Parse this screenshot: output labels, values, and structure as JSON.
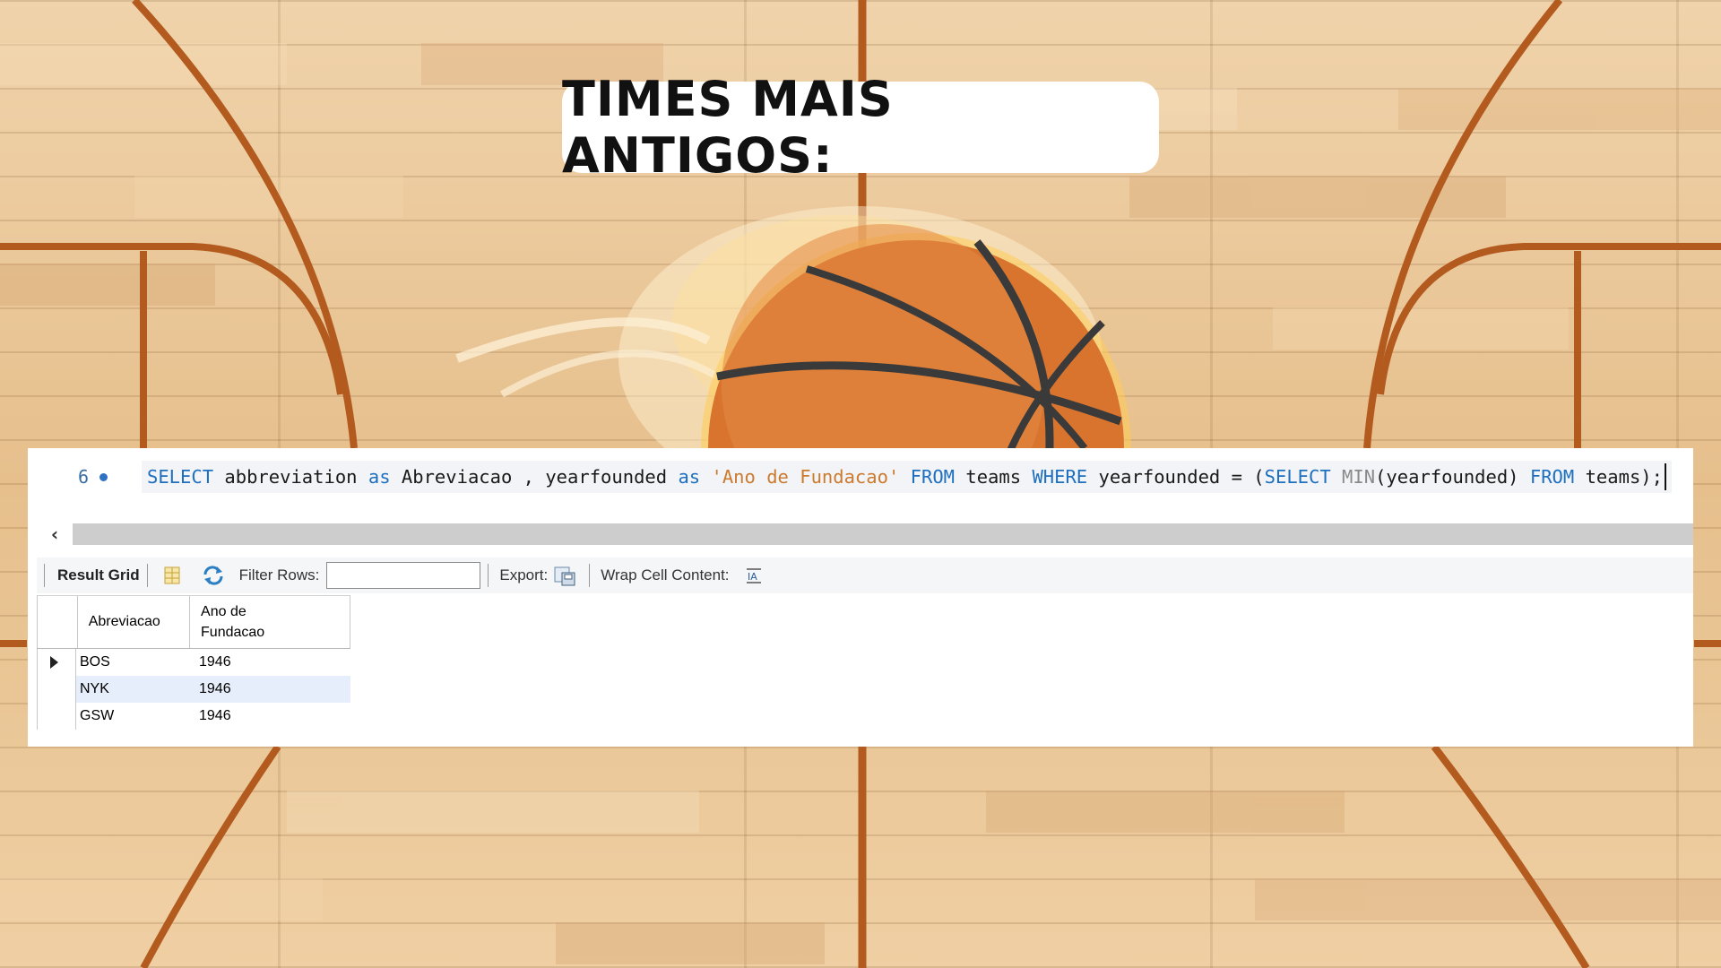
{
  "title": "TIMES MAIS ANTIGOS:",
  "editor": {
    "line_number": "6",
    "code_tokens": [
      {
        "t": "SELECT",
        "c": "kw"
      },
      {
        "t": " abbreviation ",
        "c": ""
      },
      {
        "t": "as",
        "c": "kw"
      },
      {
        "t": " Abreviacao , yearfounded ",
        "c": ""
      },
      {
        "t": "as",
        "c": "kw"
      },
      {
        "t": " ",
        "c": ""
      },
      {
        "t": "'Ano de Fundacao'",
        "c": "str"
      },
      {
        "t": " ",
        "c": ""
      },
      {
        "t": "FROM",
        "c": "kw"
      },
      {
        "t": " teams ",
        "c": ""
      },
      {
        "t": "WHERE",
        "c": "kw"
      },
      {
        "t": " yearfounded = (",
        "c": ""
      },
      {
        "t": "SELECT",
        "c": "kw"
      },
      {
        "t": " ",
        "c": ""
      },
      {
        "t": "MIN",
        "c": "fn"
      },
      {
        "t": "(yearfounded) ",
        "c": ""
      },
      {
        "t": "FROM",
        "c": "kw"
      },
      {
        "t": " teams);",
        "c": ""
      }
    ]
  },
  "toolbar": {
    "result_grid": "Result Grid",
    "filter_rows": "Filter Rows:",
    "filter_value": "",
    "export": "Export:",
    "wrap_cell": "Wrap Cell Content:"
  },
  "grid": {
    "columns": [
      "Abreviacao",
      "Ano de Fundacao"
    ],
    "rows": [
      [
        "BOS",
        "1946"
      ],
      [
        "NYK",
        "1946"
      ],
      [
        "GSW",
        "1946"
      ]
    ],
    "selected_row": 1,
    "current_row": 0
  },
  "colors": {
    "keyword": "#1f6fbf",
    "string": "#cc7a2e",
    "function": "#8a8a8a",
    "court_line": "#b35a1f",
    "ball": "#d8742e"
  }
}
